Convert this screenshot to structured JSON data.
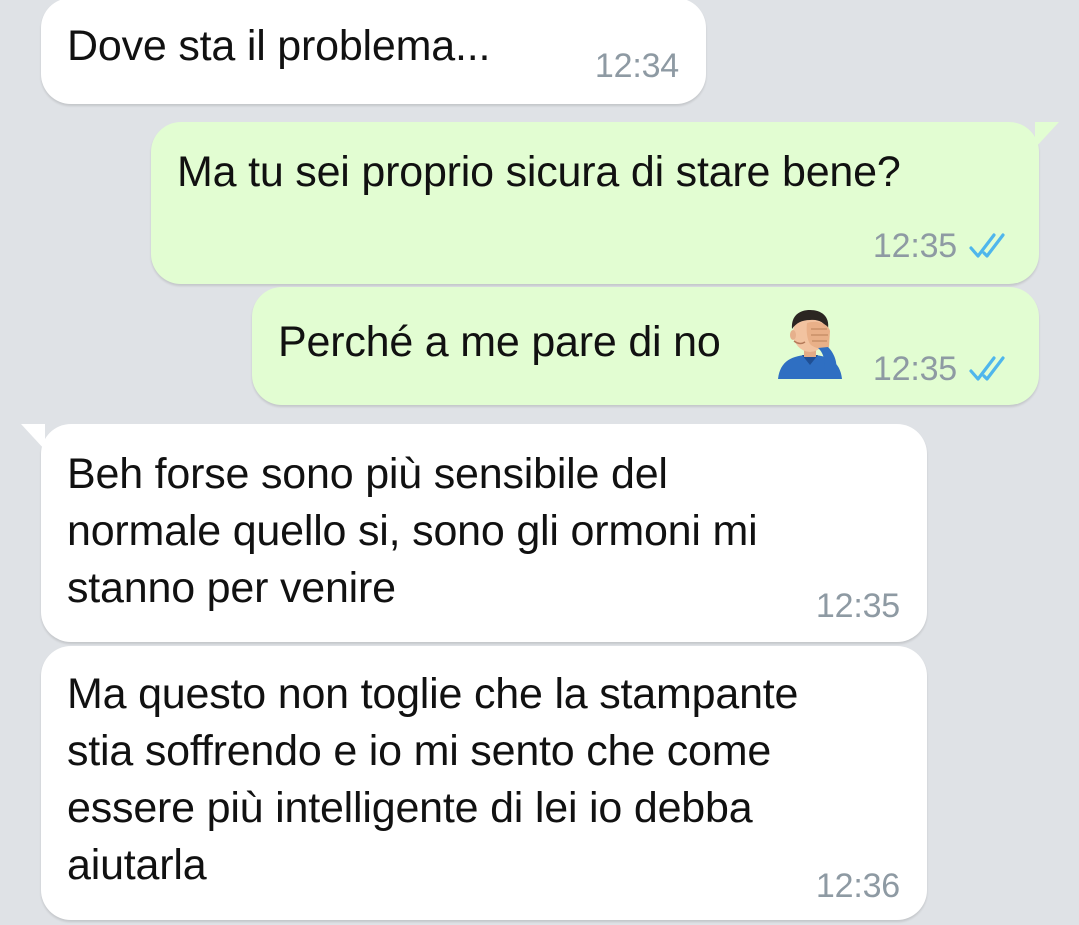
{
  "colors": {
    "background": "#dfe2e6",
    "incoming_bubble": "#ffffff",
    "outgoing_bubble": "#e2fdd2",
    "timestamp": "#8e9aa3",
    "read_ticks": "#4fb6ec"
  },
  "messages": [
    {
      "direction": "incoming",
      "text": "Dove sta il problema...",
      "time": "12:34"
    },
    {
      "direction": "outgoing",
      "text": "Ma tu sei proprio sicura di stare bene?",
      "time": "12:35",
      "status": "read-double-check-icon"
    },
    {
      "direction": "outgoing",
      "text": "Perché a me pare di no",
      "emoji": "man-facepalming-emoji",
      "time": "12:35",
      "status": "read-double-check-icon"
    },
    {
      "direction": "incoming",
      "text": "Beh forse sono più sensibile del\nnormale quello si, sono gli ormoni mi\nstanno per venire",
      "time": "12:35"
    },
    {
      "direction": "incoming",
      "text": "Ma questo non toglie che la stampante\nstia soffrendo e io mi sento che come\nessere più intelligente di lei io debba\naiutarla",
      "time": "12:36"
    }
  ]
}
